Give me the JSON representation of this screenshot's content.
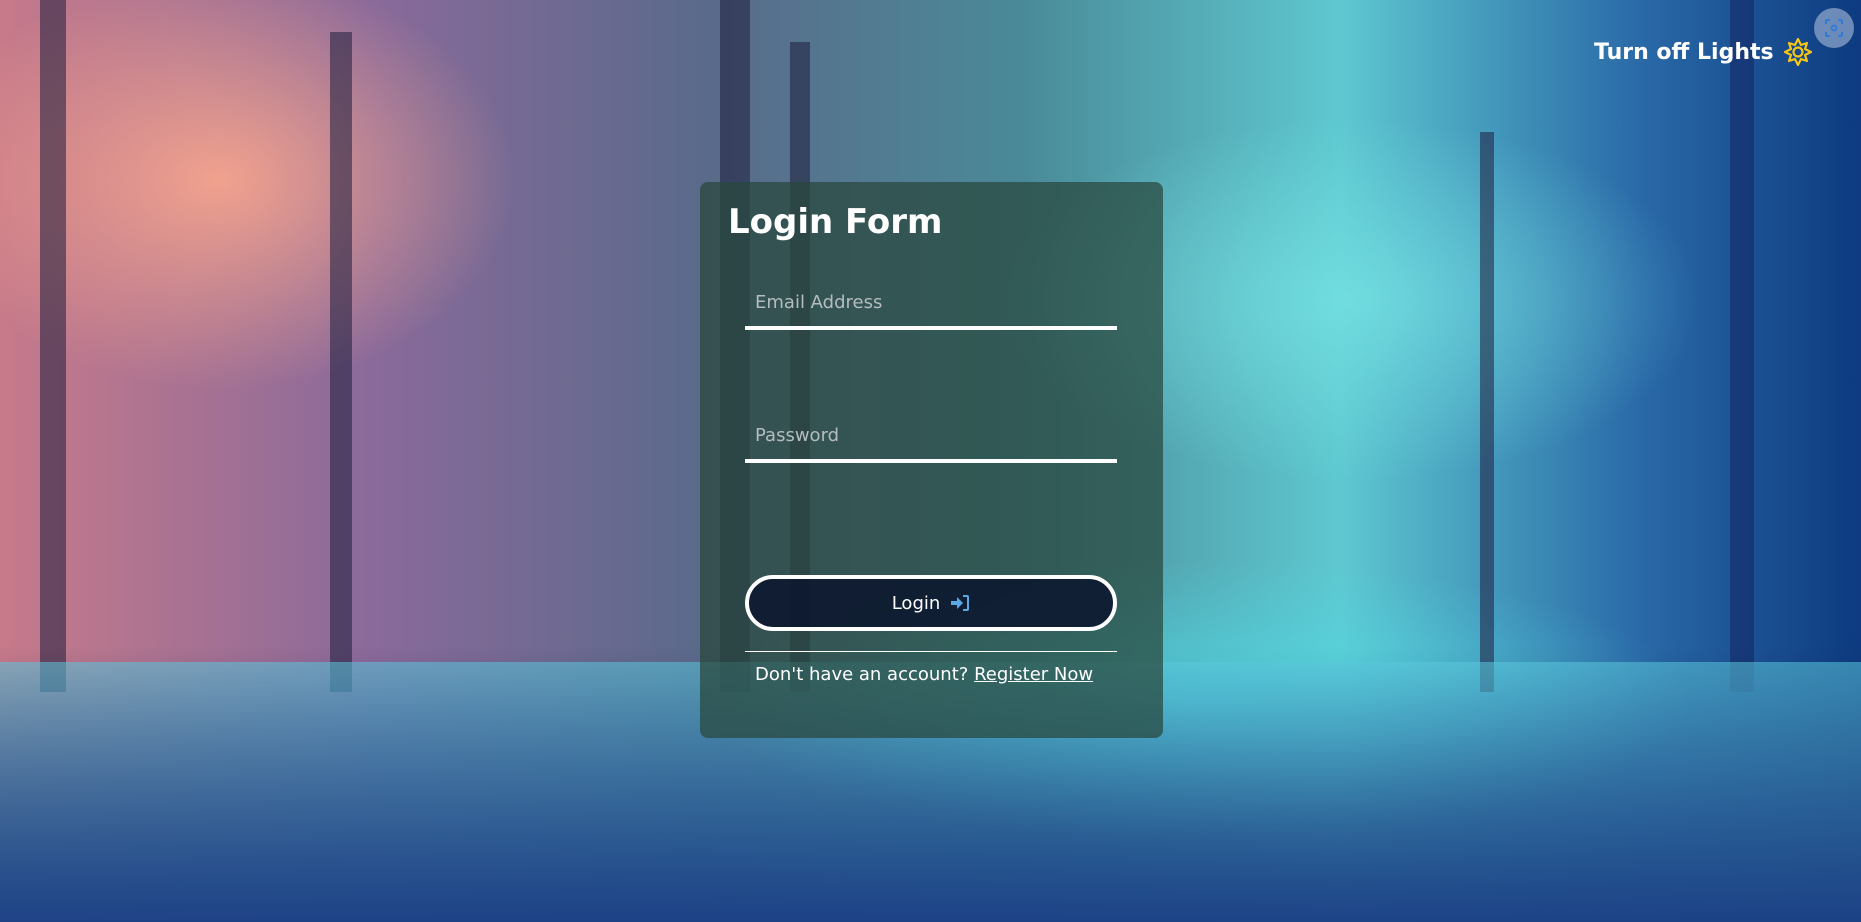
{
  "header": {
    "lights_label": "Turn off Lights",
    "lights_icon": "sun-icon",
    "capture_icon": "screenshot-icon"
  },
  "form": {
    "title": "Login Form",
    "email_placeholder": "Email Address",
    "email_value": "",
    "password_placeholder": "Password",
    "password_value": "",
    "login_label": "Login",
    "login_icon": "sign-in-icon",
    "footer_text": "Don't have an account?",
    "register_link": "Register Now"
  },
  "colors": {
    "sun": "#f5c518",
    "login_icon": "#5aa8e8"
  }
}
